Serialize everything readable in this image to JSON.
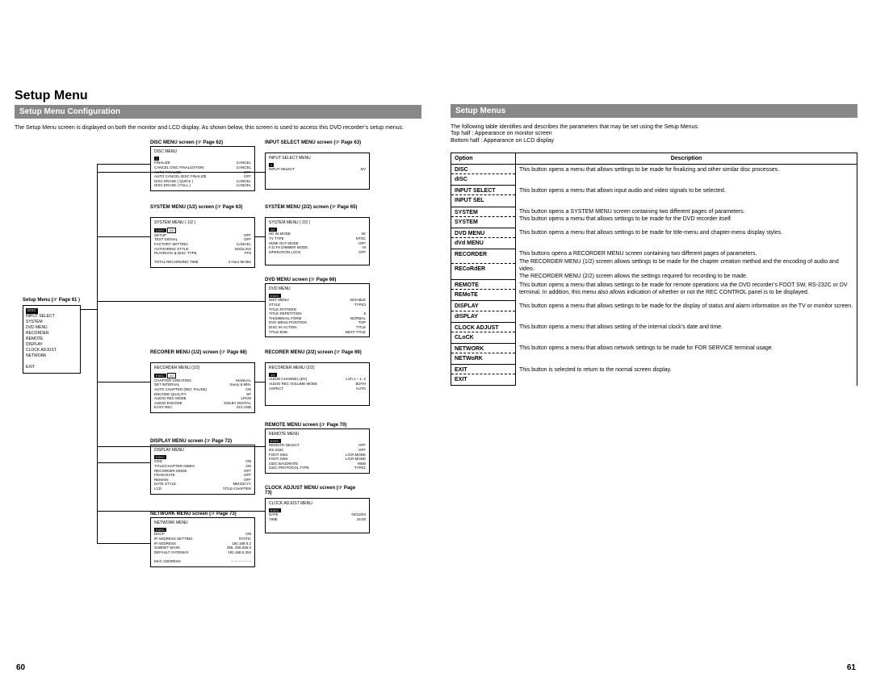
{
  "header": {
    "title": "Setup Menu"
  },
  "left": {
    "sub": "Setup Menu Configuration",
    "intro": "The Setup Menu screen is displayed on both the monitor and LCD display. As shown below, this screen is used to access this DVD recorder’s setup menus.",
    "root": {
      "label": "Setup Menu (☞ Page 61 )",
      "highlight": "DISC",
      "items": [
        "INPUT SELECT",
        "SYSTEM",
        "DVD MENU",
        "RECORDER",
        "REMOTE",
        "DISPLAY",
        "CLOCK ADJUST",
        "NETWORK",
        "",
        "EXIT"
      ]
    },
    "boxes": {
      "disc": {
        "label": "DISC MENU screen (☞ Page 62)",
        "title": "DISC MENU",
        "rows": [
          [
            "FINALIZE",
            "CANCEL"
          ],
          [
            "CANCEL DISC FINALIZATION",
            "CANCEL"
          ],
          [
            "AUTO FINALIZE",
            "OFF"
          ],
          [
            "AUTO CANCEL DISC FINALIZE",
            "OFF"
          ],
          [
            "DISC ERASE ( QUICK )",
            "CANCEL"
          ],
          [
            "DISC ERASE ( FULL )",
            "CANCEL"
          ]
        ]
      },
      "input": {
        "label": "INPUT SELECT MENU screen (☞ Page 63)",
        "title": "INPUT SELECT MENU",
        "rows": [
          [
            "INPUT SELECT",
            "DV"
          ]
        ]
      },
      "sys1": {
        "label": "SYSTEM MENU (1/2) screen (☞ Page 63)",
        "title": "SYSTEM MENU ( 1/2 )",
        "rows": [
          [
            "SETUP",
            "OFF"
          ],
          [
            "TEST SIGNAL",
            "OFF"
          ],
          [
            "FACTORY SETTING",
            "CANCEL"
          ],
          [
            "AUTHORING STYLE",
            "ENGLISH"
          ],
          [
            "PLAYBACK & DISC TYPE",
            "FP3"
          ]
        ],
        "footer": [
          "TOTAL RECORDING TIME",
          "4 Hour 58 Min"
        ]
      },
      "sys2": {
        "label": "SYSTEM MENU (2/2) screen (☞ Page 65)",
        "title": "SYSTEM MENU ( 2/2 )",
        "rows": [
          [
            "HD IN MODE",
            "2K"
          ],
          [
            "TV TYPE",
            "NTSC"
          ],
          [
            "HDMI OUT MODE",
            "OFF"
          ],
          [
            "F.D.TH DIMMER MODE",
            "HI"
          ],
          [
            "OPERATION LOCK",
            "OFF"
          ]
        ]
      },
      "dvd": {
        "label": "DVD MENU screen (☞ Page 66)",
        "title": "DVD MENU",
        "rows": [
          [
            "EDIT MENU",
            "DISABLE"
          ],
          [
            "STYLE",
            "TYPE3"
          ],
          [
            "TITLE PATTERN",
            ""
          ],
          [
            "TITLE REPETITION",
            "5"
          ],
          [
            "THUMBNAIL FORM",
            "NORMAL"
          ],
          [
            "DVD MENU POSITION",
            "TOP"
          ],
          [
            "DISC IN ACTION",
            "TITLE"
          ],
          [
            "TITLE END",
            "NEXT TITLE"
          ]
        ]
      },
      "rec1": {
        "label": "RECORER MENU (1/2) screen (☞ Page 68)",
        "title": "RECORDER MENU (1/2)",
        "rows": [
          [
            "CHAPTER CREATION",
            "MANUAL"
          ],
          [
            "SET INTERVAL",
            "Every 5 MIN."
          ],
          [
            "AUTO CHAPTER (REC PAUSE)",
            "ON"
          ],
          [
            "ENCODE QUALITY",
            "SP"
          ],
          [
            "AUDIO REC MODE",
            "LPCM"
          ],
          [
            "AUDIO ENCODE",
            "DOLBY DIGITAL"
          ],
          [
            "EASY REC",
            "SCI-USB"
          ]
        ]
      },
      "rec2": {
        "label": "RECORER MENU (2/2) screen (☞ Page 69)",
        "title": "RECORDER MENU (2/2)",
        "rows": [
          [
            "AUDIO CHANNEL (DV)",
            "L/ch.1 – 1. 2"
          ],
          [
            "AUDIO REC VOLUME MODE",
            "BOTH"
          ],
          [
            "ASPECT",
            "AUTO"
          ]
        ]
      },
      "remote": {
        "label": "REMOTE MENU screen (☞ Page 70)",
        "title": "REMOTE MENU",
        "rows": [
          [
            "REMOTE SELECT",
            "OFF"
          ],
          [
            "RS-232C",
            "OFF"
          ],
          [
            "FOOT SW1",
            "L/CR MODE"
          ],
          [
            "FOOT SW2",
            "L/CR MODE"
          ],
          [
            "232C BAUDRATE",
            "9600"
          ],
          [
            "232C PROTOCOL TYPE",
            "TYPE1"
          ]
        ]
      },
      "display": {
        "label": "DISPLAY MENU screen (☞ Page 72)",
        "title": "DISPLAY MENU",
        "rows": [
          [
            "OSD",
            "ON"
          ],
          [
            "TITLE/CHAPTER INDEX",
            "ON"
          ],
          [
            "RECORDER MODE",
            "OFF"
          ],
          [
            "FRAM RATE",
            "OFF"
          ],
          [
            "REMAIN",
            "OFF"
          ],
          [
            "DATE STYLE",
            "MM:DD:YY"
          ],
          [
            "LCD",
            "TITLE-CHAPTER"
          ]
        ]
      },
      "clock": {
        "label": "CLOCK ADJUST MENU screen (☞ Page 73)",
        "title": "CLOCK ADJUST MENU",
        "rows": [
          [
            "DATE",
            "04/12/04"
          ],
          [
            "TIME",
            "15:00"
          ]
        ]
      },
      "network": {
        "label": "NETWORK MENU screen (☞ Page 73)",
        "title": "NETWORK MENU",
        "rows": [
          [
            "DHCP",
            "ON"
          ],
          [
            "IP ADDRESS SETTING",
            "STATIC"
          ],
          [
            "IP ADDRESS",
            "192.168.0.2"
          ],
          [
            "SUBNET MASK",
            "255. 255.255.0"
          ],
          [
            "DEFAULT GATEWAY",
            "192.168.0.254"
          ]
        ],
        "footer": [
          "MAC ADDRESS",
          "-- -- -- -- -- --"
        ]
      }
    }
  },
  "right": {
    "sub": "Setup Menus",
    "intro1": "The following table identifies and describes the parameters that may be set using the Setup Menus.",
    "intro2": "Top half        : Appearance on monitor screen",
    "intro3": "Bottom half  : Appearance on LCD display",
    "th_opt": "Option",
    "th_desc": "Description",
    "rows": [
      {
        "opt": "DISC",
        "lcd": "dISC",
        "desc": "This button opens a menu that allows settings to be made for finalizing and other similar disc processes."
      },
      {
        "opt": "INPUT SELECT",
        "lcd": "INPUT SEL",
        "desc": "This button opens a menu that allows input audio and video signals to be selected."
      },
      {
        "opt": "SYSTEM",
        "lcd": "SYSTEM",
        "desc": "This button opens a SYSTEM MENU screen containing two different pages of parameters.\nThis button opens a menu that allows settings to be made for the DVD recorder itself."
      },
      {
        "opt": "DVD MENU",
        "lcd": "dVd MENU",
        "desc": "This button opens a menu that allows settings to be made for title-menu and chapter-menu display styles."
      },
      {
        "opt": "RECORDER",
        "lcd": "RECoRdER",
        "desc": "This buttons opens a RECORDER MENU screen containing two different pages of parameters.\nThe RECORDER MENU (1/2) screen allows settings to be made for the chapter creation method and the encoding of audio and video.\nThe RECORDER MENU (2/2) screen allows the settings required for recording to be made."
      },
      {
        "opt": "REMOTE",
        "lcd": "REMoTE",
        "desc": "This button opens a menu that allows settings to be made for remote operations via the DVD recorder’s FOOT SW, RS-232C or DV terminal. In addition, this menu also allows indication of whether or not the REC CONTROL panel is to be displayed."
      },
      {
        "opt": "DISPLAY",
        "lcd": "dISPLAY",
        "desc": "This button opens a menu that allows settings to be made for the display of status and alarm information on the TV or monitor screen."
      },
      {
        "opt": "CLOCK ADJUST",
        "lcd": "CLoCK",
        "desc": "This button opens a menu that allows setting of the internal clock’s date and time."
      },
      {
        "opt": "NETWORK",
        "lcd": "NETWoRK",
        "desc": "This button opens a menu that allows network settings to be made for FOR SERVICE terminal usage."
      },
      {
        "opt": "EXIT",
        "lcd": "EXIT",
        "desc": "This button is selected to return to the normal screen display."
      }
    ]
  },
  "pagenums": {
    "left": "60",
    "right": "61"
  }
}
